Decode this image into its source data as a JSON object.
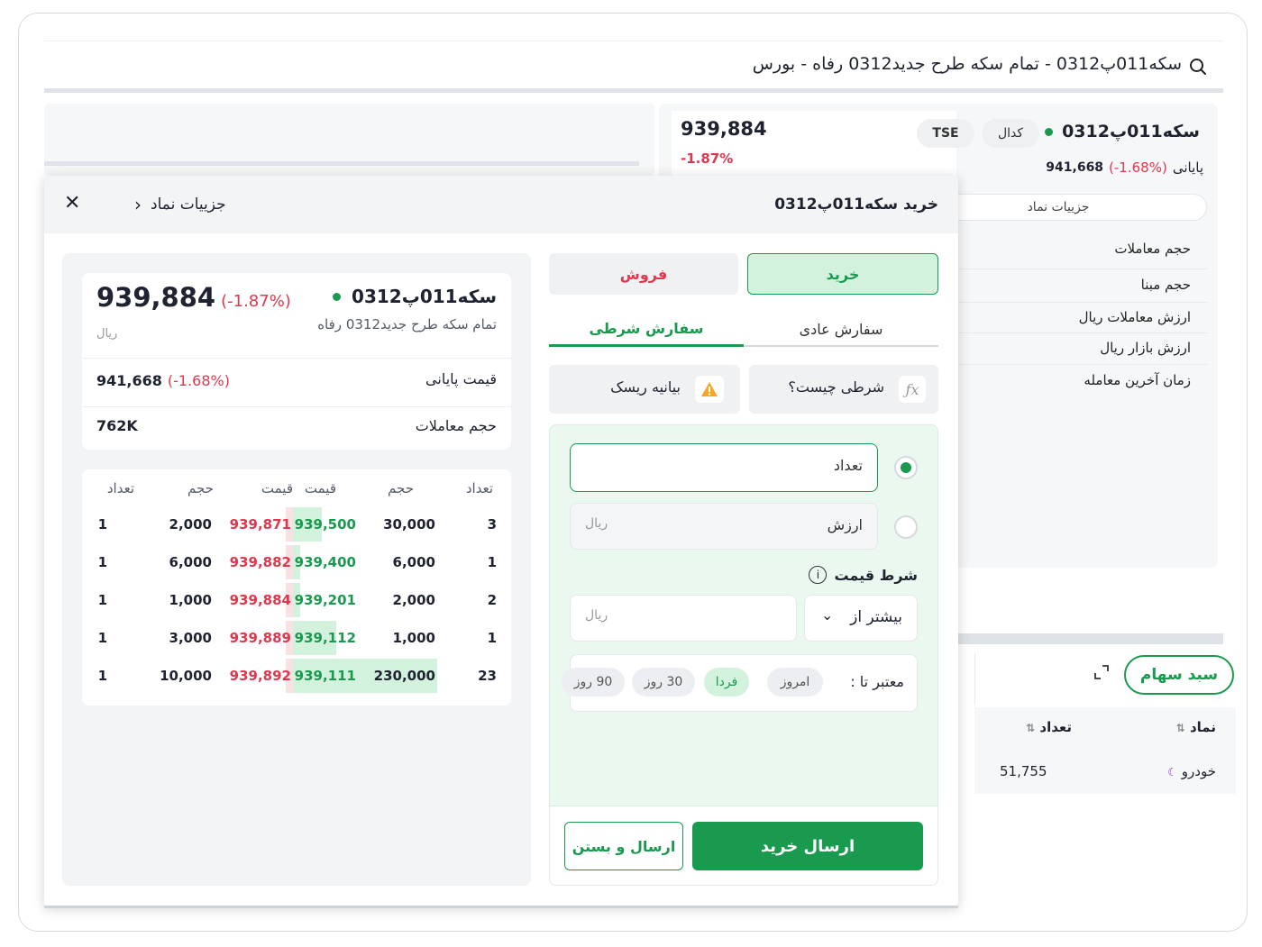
{
  "search": {
    "query": "سکه011پ0312 - تمام سکه طرح جدید0312 رفاه - بورس"
  },
  "symbol_card": {
    "name": "سکه011پ0312",
    "badge_codal": "کدال",
    "badge_tse": "TSE",
    "last_price": "939,884",
    "last_change": "-1.87%",
    "closing_label": "پایانی",
    "closing_change": "(-1.68%)",
    "closing_price": "941,668",
    "details_button": "جزییات نماد",
    "rows": [
      "حجم معاملات",
      "حجم مبنا",
      "ارزش معاملات ریال",
      "ارزش بازار ریال",
      "زمان آخرین معامله"
    ]
  },
  "basket": {
    "button": "سبد سهام",
    "col_symbol": "نماد",
    "col_count": "تعداد",
    "row_symbol": "خودرو",
    "row_count": "51,755"
  },
  "modal": {
    "title": "خرید سکه011پ0312",
    "details_link": "جزییات نماد",
    "buy_tab": "خرید",
    "sell_tab": "فروش",
    "order_normal": "سفارش عادی",
    "order_conditional": "سفارش شرطی",
    "what_is_condition": "شرطی چیست؟",
    "risk_statement": "بیانیه ریسک",
    "qty_placeholder": "تعداد",
    "value_placeholder": "ارزش",
    "value_unit": "ریال",
    "price_condition_label": "شرط قیمت",
    "condition_select": "بیشتر از",
    "condition_unit": "ریال",
    "valid_until_label": "معتبر تا :",
    "valid_options": [
      "امروز",
      "فردا",
      "30 روز",
      "90 روز"
    ],
    "valid_selected": 1,
    "submit_buy": "ارسال خرید",
    "submit_close": "ارسال و بستن"
  },
  "side_info": {
    "symbol": "سکه011پ0312",
    "full_name": "تمام سکه طرح جدید0312 رفاه",
    "last_price": "939,884",
    "last_change": "(-1.87%)",
    "unit": "ریال",
    "closing_label": "قیمت پایانی",
    "closing_price": "941,668",
    "closing_change": "(-1.68%)",
    "volume_label": "حجم معاملات",
    "volume_value": "762K"
  },
  "orderbook": {
    "headers": [
      "تعداد",
      "حجم",
      "قیمت",
      "قیمت",
      "حجم",
      "تعداد"
    ],
    "rows": [
      {
        "buy_count": "3",
        "buy_vol": "30,000",
        "buy_price": "939,500",
        "sell_price": "939,871",
        "sell_vol": "2,000",
        "sell_count": "1",
        "buy_depth": 0.2,
        "sell_depth": 0.05
      },
      {
        "buy_count": "1",
        "buy_vol": "6,000",
        "buy_price": "939,400",
        "sell_price": "939,882",
        "sell_vol": "6,000",
        "sell_count": "1",
        "buy_depth": 0.05,
        "sell_depth": 0.05
      },
      {
        "buy_count": "2",
        "buy_vol": "2,000",
        "buy_price": "939,201",
        "sell_price": "939,884",
        "sell_vol": "1,000",
        "sell_count": "1",
        "buy_depth": 0.05,
        "sell_depth": 0.05
      },
      {
        "buy_count": "1",
        "buy_vol": "1,000",
        "buy_price": "939,112",
        "sell_price": "939,889",
        "sell_vol": "3,000",
        "sell_count": "1",
        "buy_depth": 0.3,
        "sell_depth": 0.05
      },
      {
        "buy_count": "23",
        "buy_vol": "230,000",
        "buy_price": "939,111",
        "sell_price": "939,892",
        "sell_vol": "10,000",
        "sell_count": "1",
        "buy_depth": 1.0,
        "sell_depth": 0.05
      }
    ]
  },
  "colors": {
    "accent": "#1a9a4f",
    "negative": "#e2364d",
    "buy_tab_bg": "#d3f2de",
    "buy_depth": "#d3f2de",
    "sell_depth": "#fbe0e4"
  }
}
